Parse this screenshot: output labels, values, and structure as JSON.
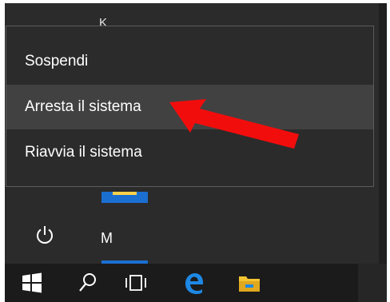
{
  "start_menu": {
    "partial_letter": "K",
    "section_letter": "M"
  },
  "power_menu": {
    "items": [
      {
        "label": "Sospendi"
      },
      {
        "label": "Arresta il sistema",
        "highlighted": true
      },
      {
        "label": "Riavvia il sistema"
      }
    ]
  },
  "annotation": {
    "arrow_color": "#f20d0d",
    "points_to": "Arresta il sistema"
  },
  "taskbar": {
    "icons": [
      "windows-start-icon",
      "search-icon",
      "task-view-icon",
      "edge-browser-icon",
      "file-explorer-icon"
    ]
  },
  "colors": {
    "menu_bg": "#2b2b2b",
    "highlight_bg": "#414141",
    "taskbar_bg": "#1b1b1b",
    "tile_blue": "#1b6fd1",
    "edge_blue": "#1e88e5",
    "folder_yellow": "#f4c430"
  }
}
